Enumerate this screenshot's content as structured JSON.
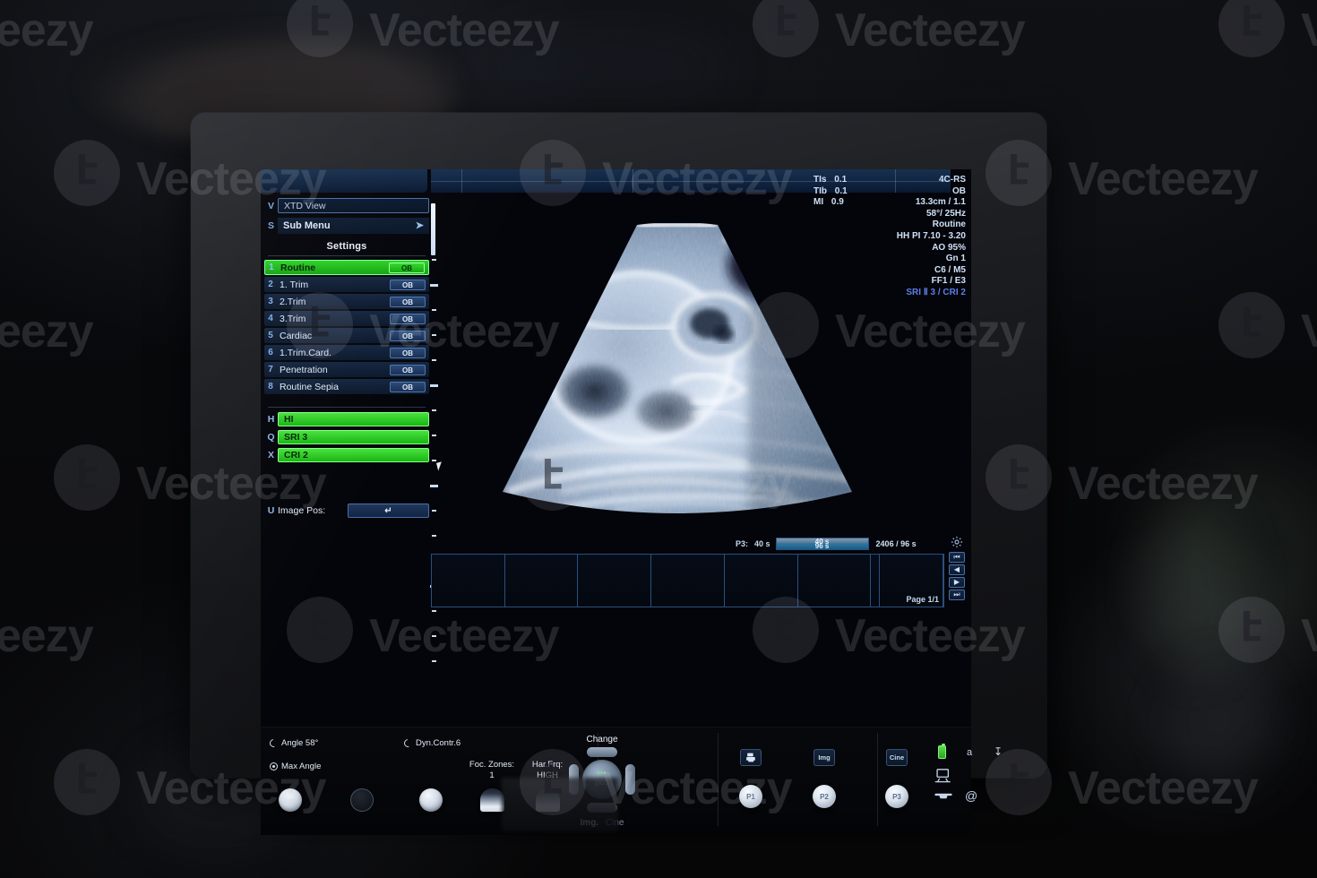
{
  "device": {
    "name": "ultrasound-scanner-console"
  },
  "panel": {
    "xtd_key": "V",
    "xtd_label": "XTD View",
    "submenu_key": "S",
    "submenu_label": "Sub Menu",
    "submenu_chevron": "chevron-right-icon",
    "settings_title": "Settings",
    "presets": [
      {
        "num": "1",
        "label": "Routine",
        "badge": "OB",
        "selected": true
      },
      {
        "num": "2",
        "label": "1. Trim",
        "badge": "OB",
        "selected": false
      },
      {
        "num": "3",
        "label": "2.Trim",
        "badge": "OB",
        "selected": false
      },
      {
        "num": "4",
        "label": "3.Trim",
        "badge": "OB",
        "selected": false
      },
      {
        "num": "5",
        "label": "Cardiac",
        "badge": "OB",
        "selected": false
      },
      {
        "num": "6",
        "label": "1.Trim.Card.",
        "badge": "OB",
        "selected": false
      },
      {
        "num": "7",
        "label": "Penetration",
        "badge": "OB",
        "selected": false
      },
      {
        "num": "8",
        "label": "Routine Sepia",
        "badge": "OB",
        "selected": false
      }
    ],
    "green_rows": [
      {
        "key": "H",
        "label": "HI"
      },
      {
        "key": "Q",
        "label": "SRI 3"
      },
      {
        "key": "X",
        "label": "CRI 2"
      }
    ],
    "image_pos_key": "U",
    "image_pos_label": "Image Pos:",
    "image_pos_value": "↵"
  },
  "params": {
    "tis_label": "TIs",
    "tis_value": "0.1",
    "tib_label": "TIb",
    "tib_value": "0.1",
    "mi_label": "MI",
    "mi_value": "0.9",
    "probe": "4C-RS",
    "exam": "OB",
    "depth_gain": "13.3cm / 1.1",
    "angle_rate": "58°/ 25Hz",
    "preset": "Routine",
    "hh_pi": "HH PI 7.10 - 3.20",
    "ao": "AO 95%",
    "gn": "Gn  1",
    "cm": "C6 / M5",
    "ff": "FF1 / E3",
    "sri_cri": "SRI Ⅱ 3 / CRI 2",
    "sri_color": "#5d7fe8"
  },
  "cine": {
    "p3_label": "P3:",
    "p3_value": "40 s",
    "bar_top": "40 s",
    "bar_bottom": "96 s",
    "counter": "2406 / 96 s"
  },
  "filmstrip": {
    "page_label": "Page 1/1",
    "cells": 7,
    "nav": [
      {
        "name": "first-frame-button",
        "glyph": "⏮"
      },
      {
        "name": "prev-frame-button",
        "glyph": "◀"
      },
      {
        "name": "next-frame-button",
        "glyph": "▶"
      },
      {
        "name": "last-frame-button",
        "glyph": "⏭"
      }
    ],
    "gear": "gear-icon"
  },
  "deck": {
    "angle_label": "Angle 58°",
    "max_angle_label": "Max Angle",
    "dyn_contr_label": "Dyn.Contr.6",
    "foc_zones_label": "Foc. Zones:",
    "foc_zones_value": "1",
    "har_frq_label": "Har.Frq:",
    "har_frq_value": "HIGH",
    "joystick": {
      "top_label": "Change",
      "led": "•••",
      "center_label": "pos",
      "bottom_left": "Img.",
      "bottom_right": "Cine"
    },
    "square_buttons": [
      {
        "name": "print-button",
        "label": ""
      },
      {
        "name": "img-button",
        "label": "Img"
      },
      {
        "name": "cine-button",
        "label": "Cine"
      }
    ],
    "p_buttons": [
      {
        "name": "p1-button",
        "label": "P1"
      },
      {
        "name": "p2-button",
        "label": "P2"
      },
      {
        "name": "p3-button",
        "label": "P3"
      }
    ],
    "status_icons": [
      {
        "name": "battery-icon",
        "glyph": ""
      },
      {
        "name": "keyboard-a-icon",
        "glyph": "a"
      },
      {
        "name": "usb-icon",
        "glyph": "⬇"
      },
      {
        "name": "network-icon",
        "glyph": ""
      },
      {
        "name": "phone-icon",
        "glyph": "☎"
      },
      {
        "name": "email-icon",
        "glyph": "@"
      }
    ]
  },
  "watermark": {
    "word": "Vecteezy",
    "logo_glyph": "է"
  }
}
